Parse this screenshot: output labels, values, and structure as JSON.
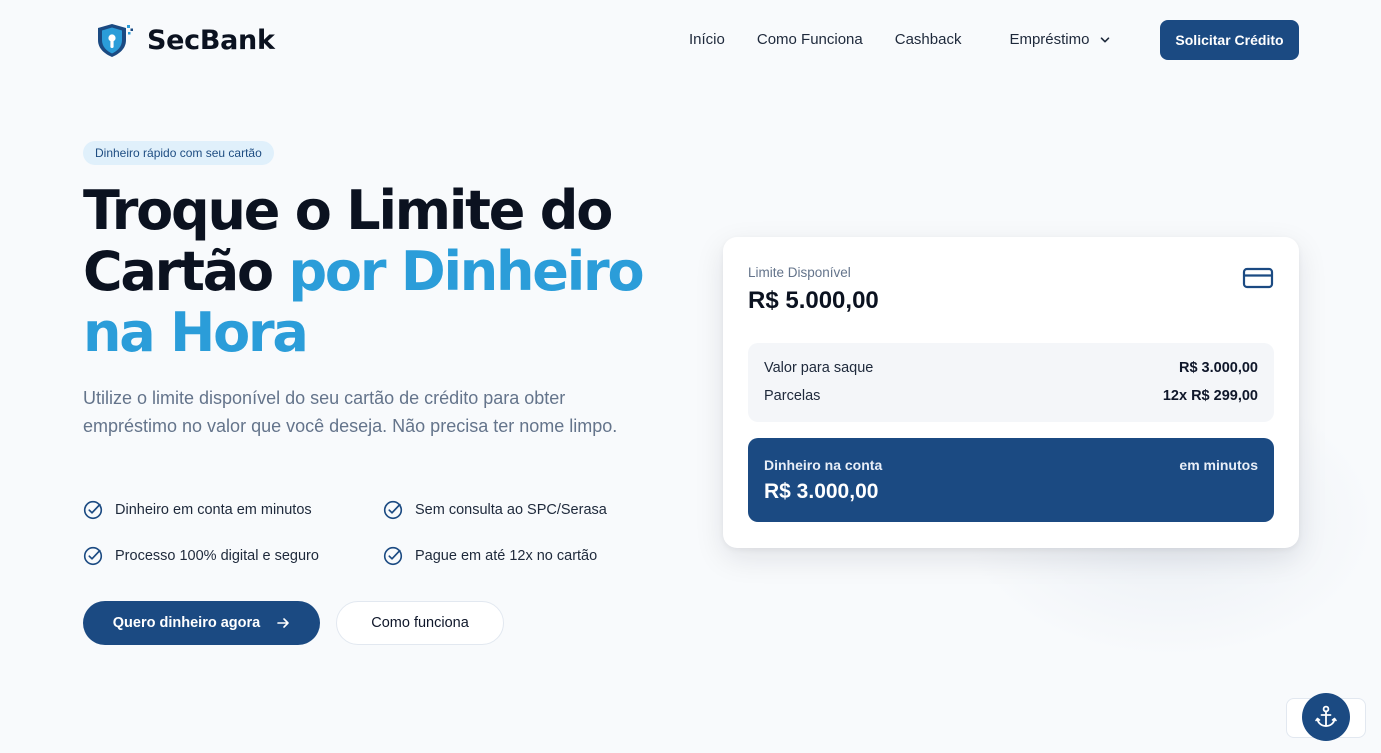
{
  "header": {
    "brand": "SecBank",
    "logo_icon": "shield-lock-icon",
    "nav": [
      {
        "label": "Início"
      },
      {
        "label": "Como Funciona"
      },
      {
        "label": "Cashback"
      },
      {
        "label": "Empréstimo",
        "icon": "chevron-down-icon"
      }
    ],
    "cta_label": "Solicitar Crédito"
  },
  "hero": {
    "badge": "Dinheiro rápido com seu cartão",
    "title_line1": "Troque o Limite do",
    "title_line2_plain": "Cartão",
    "title_line2_accent": "por Dinheiro",
    "title_line3_accent": "na Hora",
    "description": "Utilize o limite disponível do seu cartão de crédito para obter empréstimo no valor que você deseja. Não precisa ter nome limpo.",
    "features": [
      "Dinheiro em conta em minutos",
      "Sem consulta ao SPC/Serasa",
      "Processo 100% digital e seguro",
      "Pague em até 12x no cartão"
    ],
    "primary_cta": "Quero dinheiro agora",
    "secondary_cta": "Como funciona"
  },
  "card": {
    "limit_label": "Limite Disponível",
    "limit_value": "R$ 5.000,00",
    "icon": "credit-card-icon",
    "summary": [
      {
        "label": "Valor para saque",
        "value": "R$ 3.000,00"
      },
      {
        "label": "Parcelas",
        "value": "12x R$ 299,00"
      }
    ],
    "money_label": "Dinheiro na conta",
    "money_when": "em minutos",
    "money_value": "R$ 3.000,00"
  },
  "floating": {
    "icon": "anchor-icon"
  },
  "colors": {
    "primary": "#1b4a82",
    "accent": "#2b9dd9",
    "background": "#f8fafc",
    "text": "#0b1220",
    "muted": "#64748b"
  }
}
